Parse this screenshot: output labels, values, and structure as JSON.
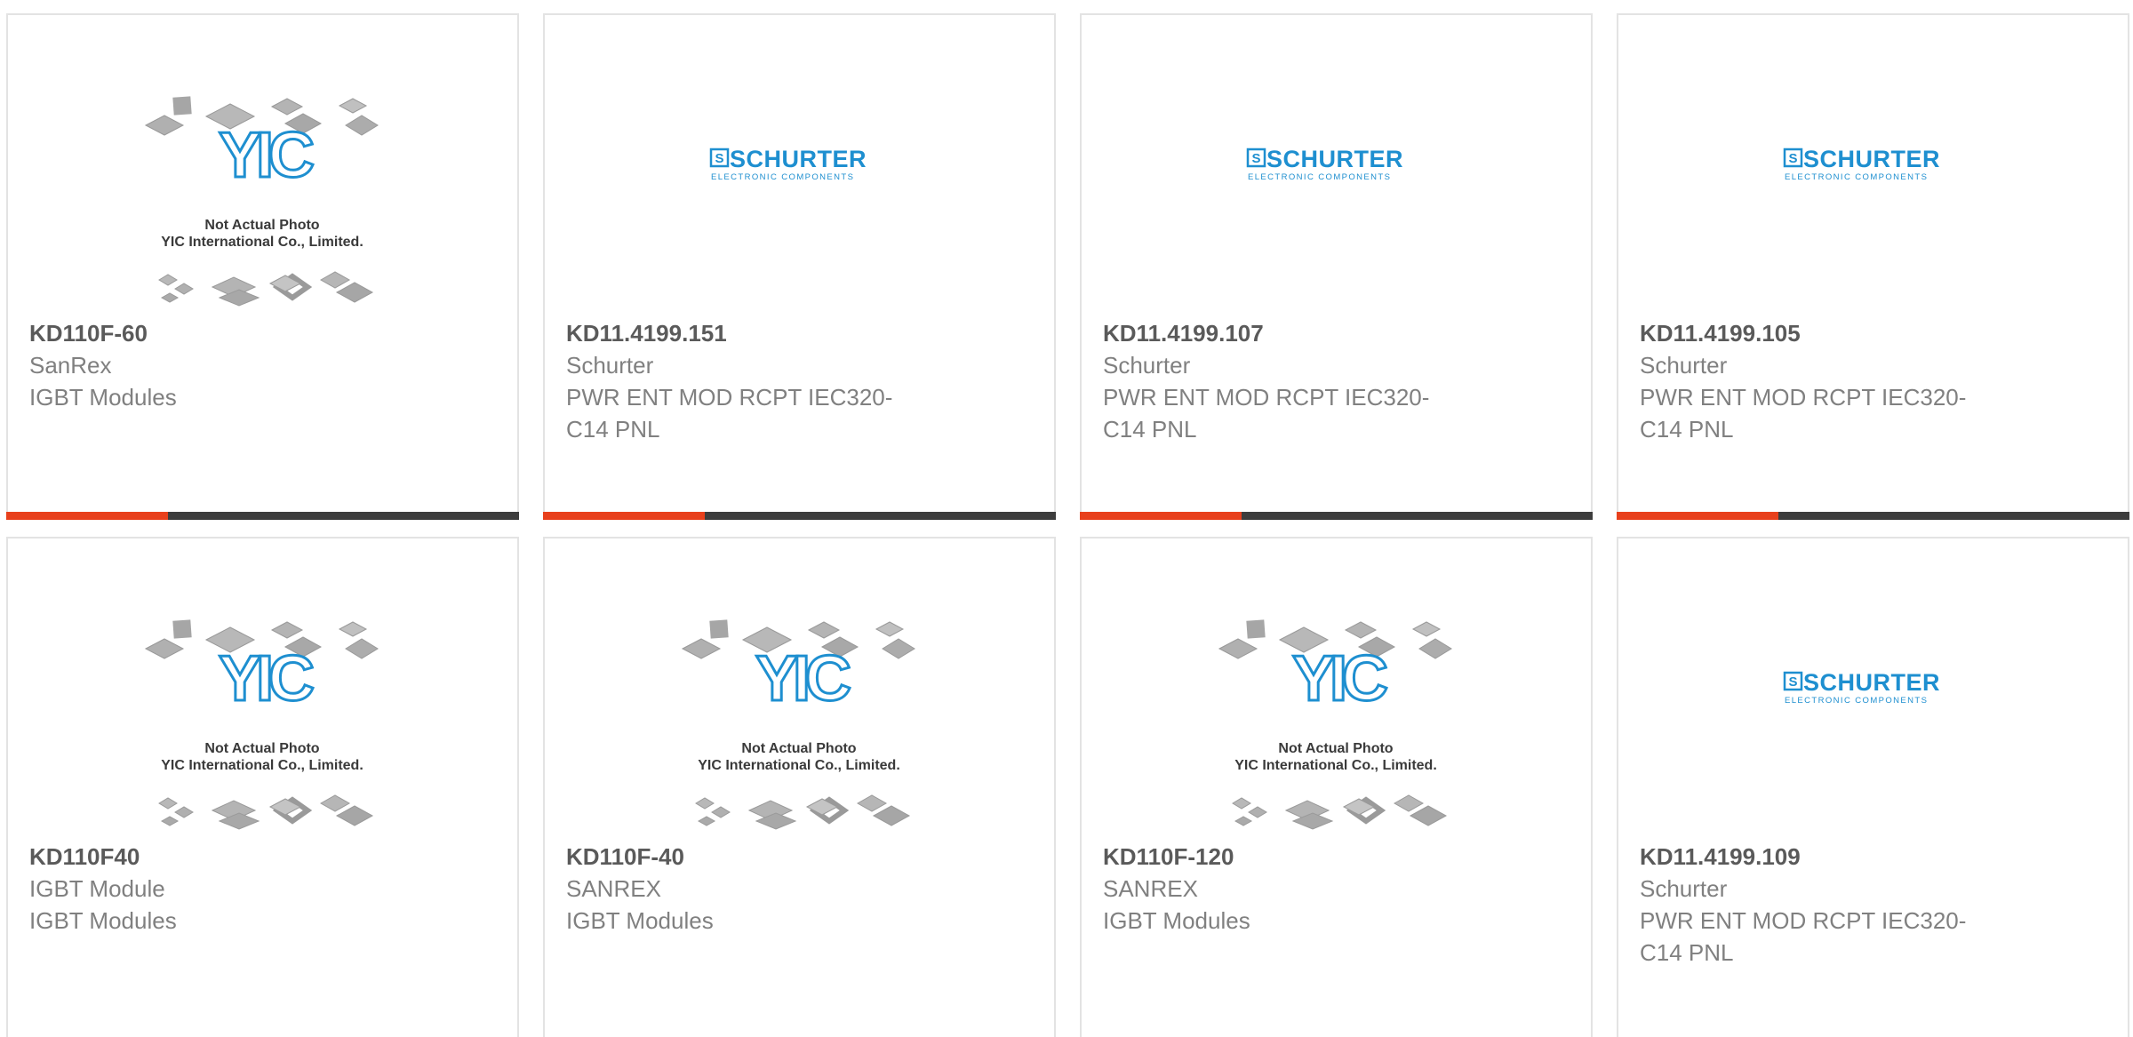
{
  "colors": {
    "accent_orange": "#e8401c",
    "accent_dark": "#3d3d3d",
    "card_border": "#e3e3e3",
    "part_number": "#5a5a5a",
    "secondary_text": "#808080",
    "schurter_blue": "#1e8fd0"
  },
  "placeholder_image": {
    "logo_text": "YIC",
    "line1": "Not Actual Photo",
    "line2": "YIC International Co., Limited."
  },
  "schurter_logo": {
    "brand": "SCHURTER",
    "tagline": "ELECTRONIC COMPONENTS"
  },
  "products": [
    {
      "part_number": "KD110F-60",
      "manufacturer": "SanRex",
      "description_line1": "IGBT Modules",
      "description_line2": "",
      "image": "yic-placeholder"
    },
    {
      "part_number": "KD11.4199.151",
      "manufacturer": "Schurter",
      "description_line1": "PWR ENT MOD RCPT IEC320-",
      "description_line2": "C14 PNL",
      "image": "schurter-logo"
    },
    {
      "part_number": "KD11.4199.107",
      "manufacturer": "Schurter",
      "description_line1": "PWR ENT MOD RCPT IEC320-",
      "description_line2": "C14 PNL",
      "image": "schurter-logo"
    },
    {
      "part_number": "KD11.4199.105",
      "manufacturer": "Schurter",
      "description_line1": "PWR ENT MOD RCPT IEC320-",
      "description_line2": "C14 PNL",
      "image": "schurter-logo"
    },
    {
      "part_number": "KD110F40",
      "manufacturer": "IGBT Module",
      "description_line1": "IGBT Modules",
      "description_line2": "",
      "image": "yic-placeholder"
    },
    {
      "part_number": "KD110F-40",
      "manufacturer": "SANREX",
      "description_line1": "IGBT Modules",
      "description_line2": "",
      "image": "yic-placeholder"
    },
    {
      "part_number": "KD110F-120",
      "manufacturer": "SANREX",
      "description_line1": "IGBT Modules",
      "description_line2": "",
      "image": "yic-placeholder"
    },
    {
      "part_number": "KD11.4199.109",
      "manufacturer": "Schurter",
      "description_line1": "PWR ENT MOD RCPT IEC320-",
      "description_line2": "C14 PNL",
      "image": "schurter-logo"
    }
  ]
}
